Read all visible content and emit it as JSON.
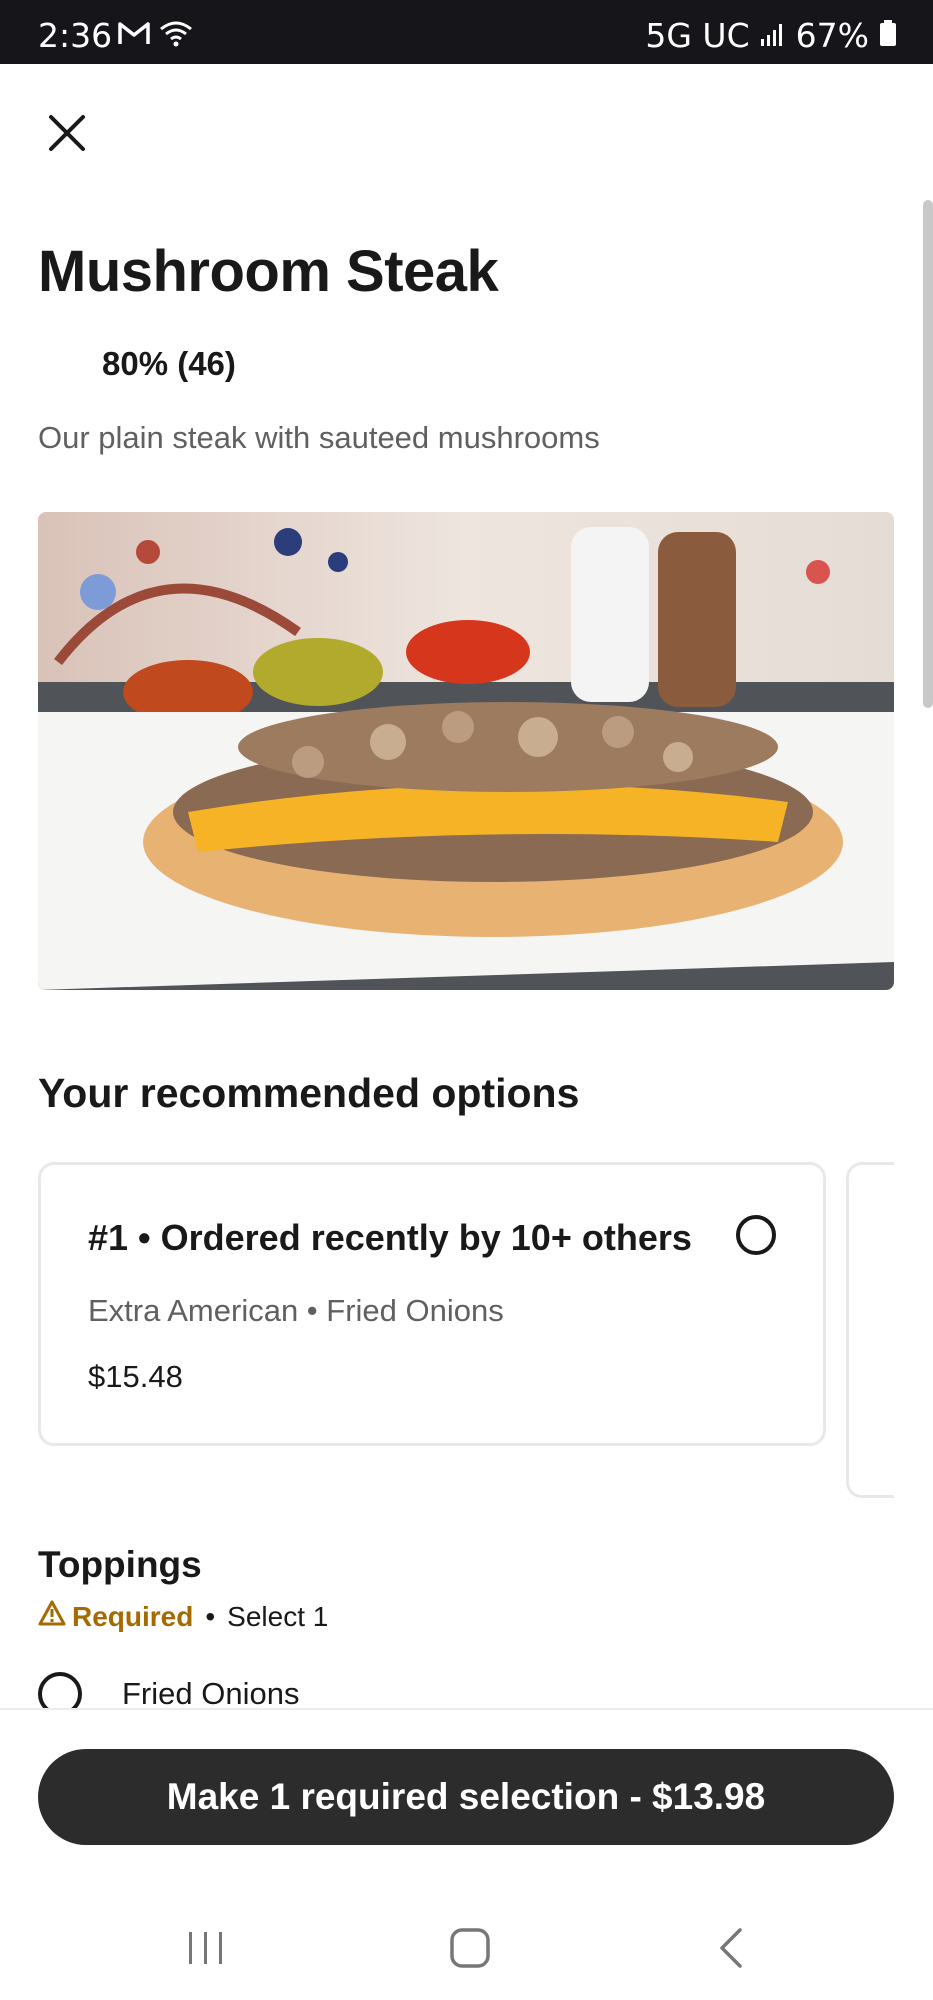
{
  "status_bar": {
    "time": "2:36",
    "network": "5G UC",
    "battery": "67%"
  },
  "item": {
    "title": "Mushroom Steak",
    "rating": "80% (46)",
    "description": "Our plain steak with sauteed mushrooms"
  },
  "recommended": {
    "heading": "Your recommended options",
    "cards": [
      {
        "title": "#1 • Ordered recently by 10+ others",
        "subtitle": "Extra American • Fried Onions",
        "price": "$15.48"
      }
    ]
  },
  "toppings": {
    "heading": "Toppings",
    "required_label": "Required",
    "select_label": "Select 1",
    "options": [
      {
        "label": "Fried Onions"
      }
    ]
  },
  "cta": {
    "label": "Make 1 required selection - $13.98"
  },
  "icons": {
    "close": "close-icon",
    "gmail": "gmail-icon",
    "wifi": "wifi-icon",
    "signal": "signal-icon",
    "battery": "battery-icon",
    "warning": "warning-icon",
    "nav_recents": "recents-icon",
    "nav_home": "home-icon",
    "nav_back": "back-icon"
  },
  "colors": {
    "required": "#a56a00",
    "cta_background": "#2c2c2c",
    "status_bar": "#16161a"
  }
}
